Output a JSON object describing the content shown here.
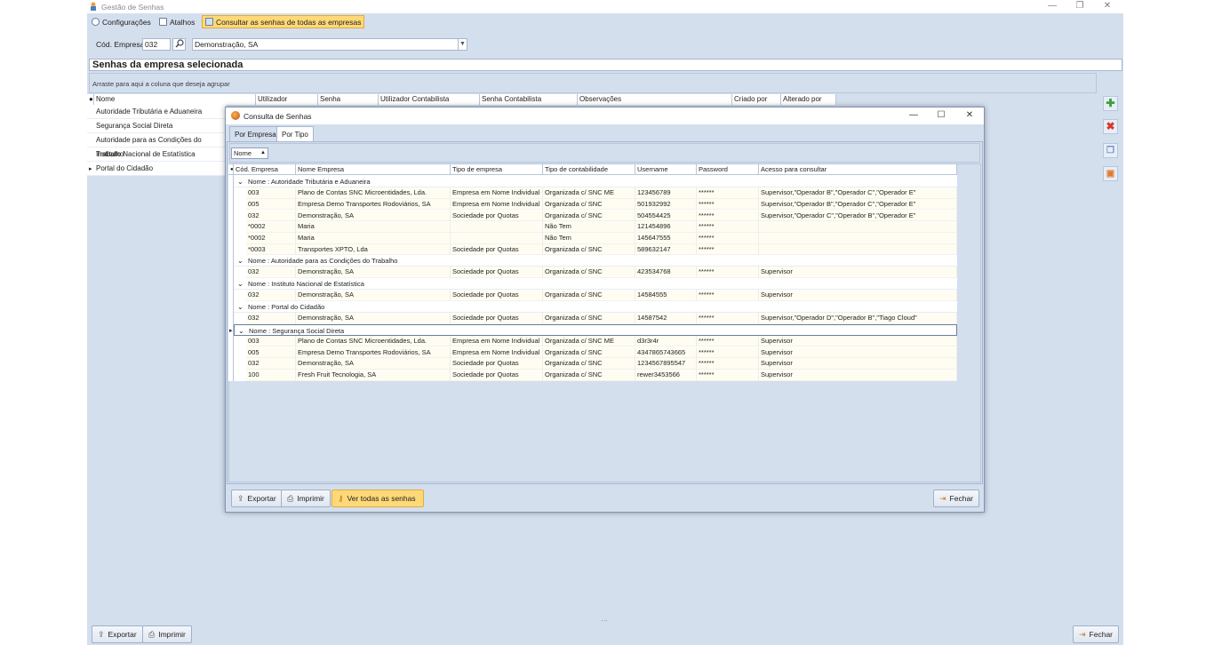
{
  "app": {
    "title": "Gestão de Senhas",
    "minimize": "—",
    "maximize": "❐",
    "close": "✕"
  },
  "menu": {
    "items": [
      {
        "label": "Configurações",
        "icon": "gear-icon"
      },
      {
        "label": "Atalhos",
        "icon": "shortcut-icon"
      },
      {
        "label": "Consultar as senhas de todas as empresas",
        "icon": "table-icon"
      }
    ]
  },
  "filter": {
    "code_label": "Cód. Empresa:",
    "code_value": "032",
    "company_value": "Demonstração, SA"
  },
  "section": {
    "title": "Senhas da empresa selecionada",
    "group_hint": "Arraste para aqui a coluna que deseja agrupar"
  },
  "main_grid": {
    "columns": [
      "Nome",
      "Utilizador",
      "Senha",
      "Utilizador Contabilista Certificado",
      "Senha Contabilista Certificado",
      "Observações",
      "Criado por",
      "Alterado por"
    ],
    "rows": [
      "Autoridade Tributária e Aduaneira",
      "Segurança Social Direta",
      "Autoridade para as Condições do Trabalho",
      "Instituto Nacional de Estatística",
      "Portal do Cidadão"
    ],
    "selected_row_marker": "▸"
  },
  "right_toolbar": {
    "add": "✚",
    "delete": "✖",
    "copy": "❐",
    "export": "▣"
  },
  "bottom": {
    "export_label": "Exportar",
    "print_label": "Imprimir",
    "close_label": "Fechar",
    "splitter": "⋯"
  },
  "modal": {
    "title": "Consulta de Senhas",
    "minimize": "—",
    "maximize": "☐",
    "close": "✕",
    "tabs": [
      "Por Empresa",
      "Por Tipo"
    ],
    "active_tab": "Por Tipo",
    "group_chip": "Nome",
    "group_chip_arrow": "▲",
    "columns": [
      "Cód. Empresa",
      "Nome Empresa",
      "Tipo de empresa",
      "Tipo de contabilidade",
      "Username",
      "Password",
      "Acesso para consultar"
    ],
    "groups": [
      {
        "label": "Nome : Autoridade Tributária e Aduaneira",
        "rows": [
          [
            "003",
            "Plano de Contas SNC Microentidades, Lda.",
            "Empresa em Nome Individual",
            "Organizada c/ SNC ME",
            "123456789",
            "******",
            "Supervisor,\"Operador B\",\"Operador C\",\"Operador E\""
          ],
          [
            "005",
            "Empresa Demo Transportes Rodoviários, SA",
            "Empresa em Nome Individual",
            "Organizada c/ SNC",
            "501932992",
            "******",
            "Supervisor,\"Operador B\",\"Operador C\",\"Operador E\""
          ],
          [
            "032",
            "Demonstração, SA",
            "Sociedade por Quotas",
            "Organizada c/ SNC",
            "504554425",
            "******",
            "Supervisor,\"Operador C\",\"Operador B\",\"Operador E\""
          ],
          [
            "*0002",
            "Maria",
            "",
            "Não Tem",
            "121454896",
            "******",
            ""
          ],
          [
            "*0002",
            "Maria",
            "",
            "Não Tem",
            "145647555",
            "******",
            ""
          ],
          [
            "*0003",
            "Transportes XPTO, Lda",
            "Sociedade por Quotas",
            "Organizada c/ SNC",
            "589632147",
            "******",
            ""
          ]
        ]
      },
      {
        "label": "Nome : Autoridade para as Condições do Trabalho",
        "rows": [
          [
            "032",
            "Demonstração, SA",
            "Sociedade por Quotas",
            "Organizada c/ SNC",
            "423534768",
            "******",
            "Supervisor"
          ]
        ]
      },
      {
        "label": "Nome : Instituto Nacional de Estatística",
        "rows": [
          [
            "032",
            "Demonstração, SA",
            "Sociedade por Quotas",
            "Organizada c/ SNC",
            "14584555",
            "******",
            "Supervisor"
          ]
        ]
      },
      {
        "label": "Nome : Portal do Cidadão",
        "rows": [
          [
            "032",
            "Demonstração, SA",
            "Sociedade por Quotas",
            "Organizada c/ SNC",
            "14587542",
            "******",
            "Supervisor,\"Operador D\",\"Operador B\",\"Tiago Cloud\""
          ]
        ]
      },
      {
        "label": "Nome : Segurança Social Direta",
        "selected": true,
        "rows": [
          [
            "003",
            "Plano de Contas SNC Microentidades, Lda.",
            "Empresa em Nome Individual",
            "Organizada c/ SNC ME",
            "d3r3r4r",
            "******",
            "Supervisor"
          ],
          [
            "005",
            "Empresa Demo Transportes Rodoviários, SA",
            "Empresa em Nome Individual",
            "Organizada c/ SNC",
            "4347865743665",
            "******",
            "Supervisor"
          ],
          [
            "032",
            "Demonstração, SA",
            "Sociedade por Quotas",
            "Organizada c/ SNC",
            "1234567895547",
            "******",
            "Supervisor"
          ],
          [
            "100",
            "Fresh Fruit Tecnologia, SA",
            "Sociedade por Quotas",
            "Organizada c/ SNC",
            "rewer3453566",
            "******",
            "Supervisor"
          ]
        ]
      }
    ],
    "group_chevron": "⌄",
    "row_marker": "▸",
    "buttons": {
      "export_label": "Exportar",
      "print_label": "Imprimir",
      "view_all_label": "Ver todas as senhas",
      "close_label": "Fechar"
    }
  }
}
